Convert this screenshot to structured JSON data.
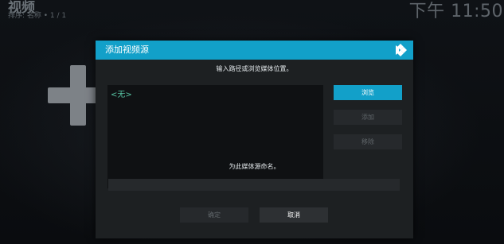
{
  "app": {
    "title": "视频",
    "subtitle": "排序: 名称  •  1 / 1",
    "clock": "下午 11:50"
  },
  "dialog": {
    "title": "添加视频源",
    "logo_icon": "kodi-logo-icon",
    "instruction": "输入路径或浏览媒体位置。",
    "path_list": [
      "<无>"
    ],
    "buttons": {
      "browse": "浏览",
      "add": "添加",
      "remove": "移除"
    },
    "name_label": "为此媒体源命名。",
    "name_value": "",
    "ok": "确定",
    "cancel": "取消"
  },
  "icons": {
    "background_add": "plus-icon"
  },
  "colors": {
    "accent": "#12a0c9",
    "dialog_bg": "#1d2022",
    "list_item_text": "#58c4a4",
    "disabled_button": "#26292c"
  }
}
